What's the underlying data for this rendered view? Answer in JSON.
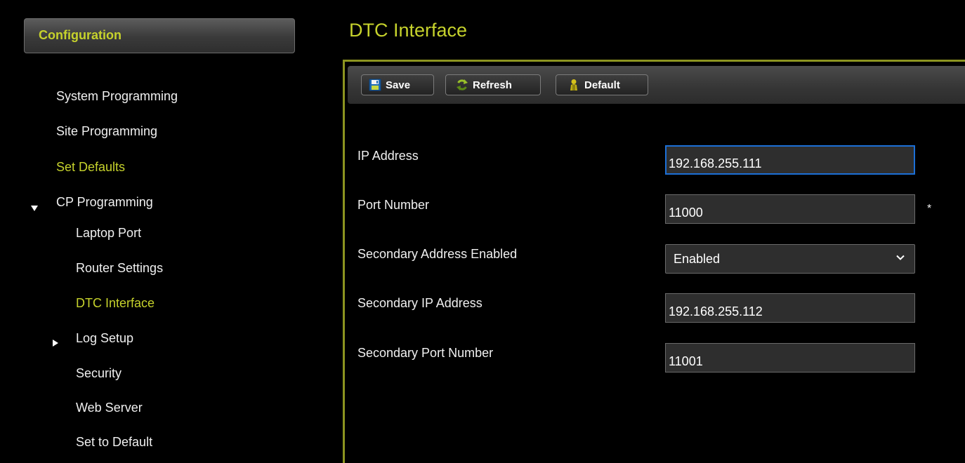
{
  "sidebar": {
    "header": "Configuration",
    "items": [
      {
        "label": "System Programming"
      },
      {
        "label": "Site Programming"
      },
      {
        "label": "Set Defaults"
      },
      {
        "label": "CP Programming"
      },
      {
        "label": "Laptop Port"
      },
      {
        "label": "Router Settings"
      },
      {
        "label": "DTC Interface"
      },
      {
        "label": "Log Setup"
      },
      {
        "label": "Security"
      },
      {
        "label": "Web Server"
      },
      {
        "label": "Set to Default"
      }
    ]
  },
  "page": {
    "title": "DTC Interface"
  },
  "toolbar": {
    "save_label": "Save",
    "refresh_label": "Refresh",
    "default_label": "Default"
  },
  "form": {
    "ip_address": {
      "label": "IP Address",
      "value": "192.168.255.111"
    },
    "port_number": {
      "label": "Port Number",
      "value": "11000",
      "required_marker": "*"
    },
    "secondary_enabled": {
      "label": "Secondary Address Enabled",
      "value": "Enabled"
    },
    "secondary_ip": {
      "label": "Secondary IP Address",
      "value": "192.168.255.112"
    },
    "secondary_port": {
      "label": "Secondary Port Number",
      "value": "11001"
    }
  },
  "colors": {
    "accent": "#c6d22c",
    "frame_border": "#8c9420",
    "focus_border": "#1c6fd6",
    "background": "#000000"
  },
  "icons": {
    "save": "floppy-disk-icon",
    "refresh": "refresh-arrows-icon",
    "default": "person-icon",
    "expanded": "triangle-down-icon",
    "collapsed": "triangle-right-icon",
    "dropdown": "chevron-down-icon"
  }
}
